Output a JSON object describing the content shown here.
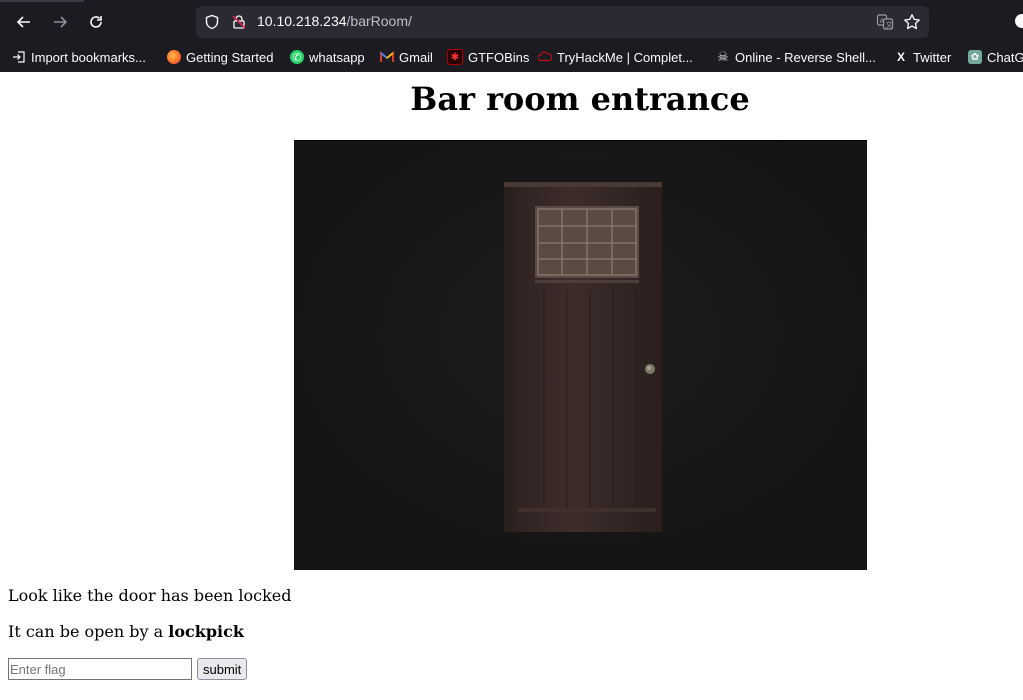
{
  "browser": {
    "url_host": "10.10.218.234",
    "url_path": "/barRoom/",
    "bookmarks": [
      {
        "label": "Import bookmarks...",
        "icon": "import-icon"
      },
      {
        "label": "Getting Started",
        "icon": "firefox-icon"
      },
      {
        "label": "whatsapp",
        "icon": "whatsapp-icon"
      },
      {
        "label": "Gmail",
        "icon": "gmail-icon"
      },
      {
        "label": "GTFOBins",
        "icon": "gtfobins-icon"
      },
      {
        "label": "TryHackMe | Complet...",
        "icon": "tryhackme-icon"
      },
      {
        "label": "Online - Reverse Shell...",
        "icon": "skull-icon"
      },
      {
        "label": "Twitter",
        "icon": "x-icon"
      },
      {
        "label": "ChatG",
        "icon": "chatgpt-icon"
      }
    ]
  },
  "page": {
    "title": "Bar room entrance",
    "line1": "Look like the door has been locked",
    "line2_prefix": "It can be open by a ",
    "line2_bold": "lockpick",
    "flag_placeholder": "Enter flag",
    "submit_label": "submit"
  },
  "colors": {
    "chrome_bg": "#1c1b22",
    "urlbar_bg": "#2b2a33",
    "image_bg": "#151515",
    "door": "#3a2b27"
  }
}
